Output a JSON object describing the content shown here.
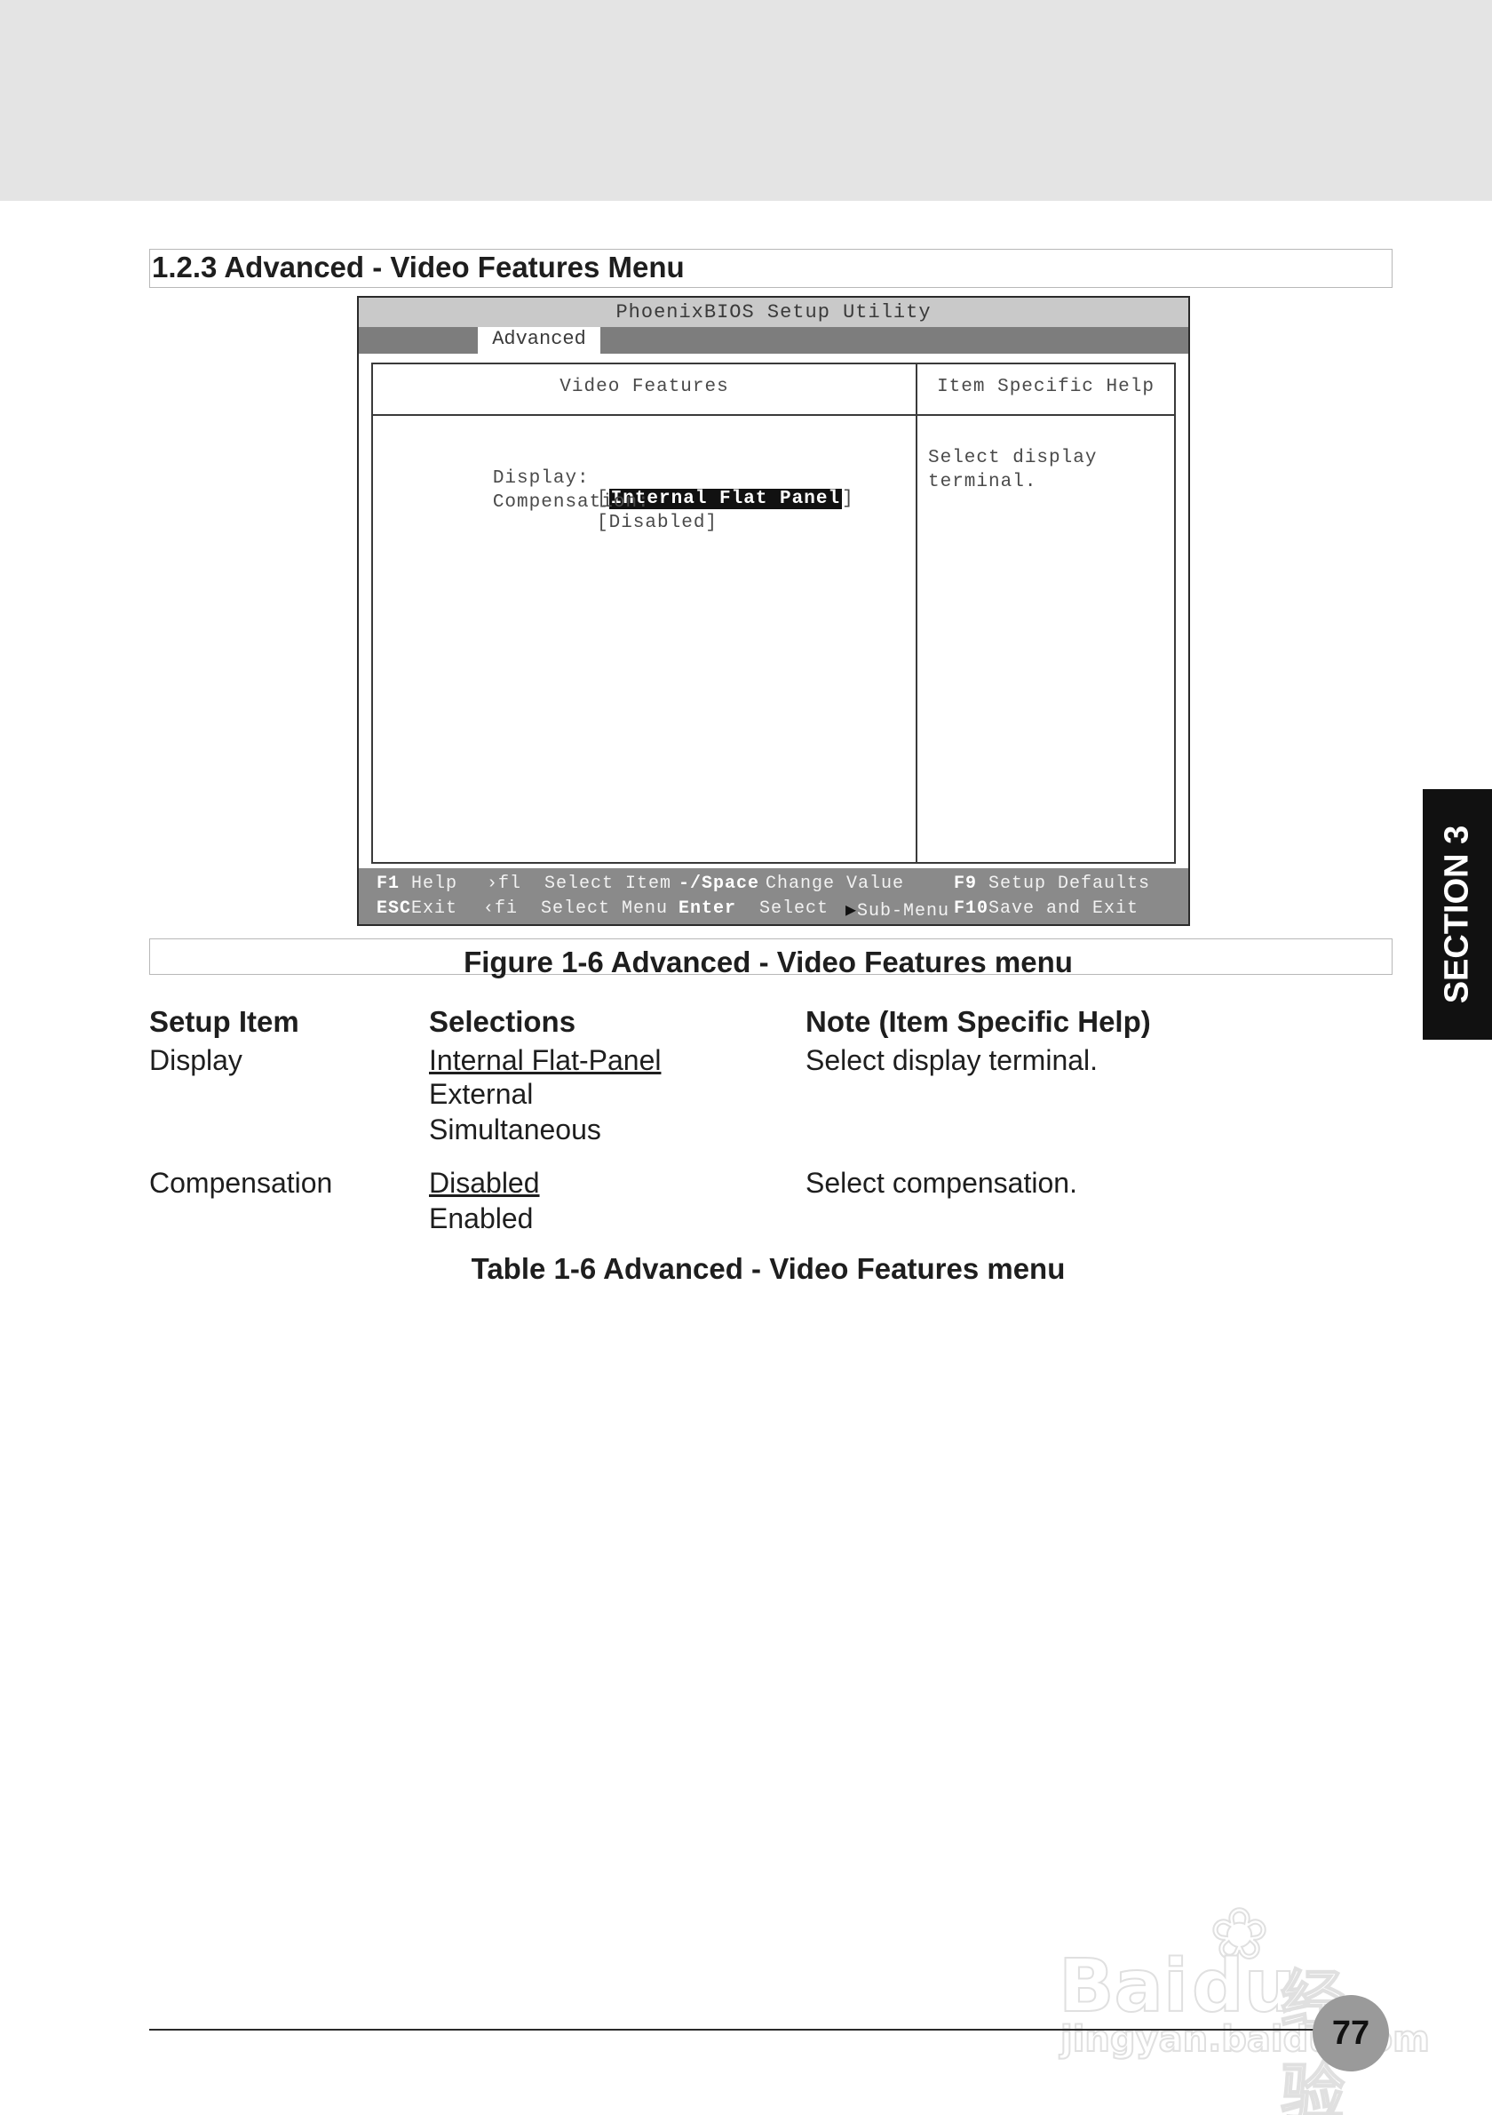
{
  "section_heading": "1.2.3 Advanced - Video Features Menu",
  "bios": {
    "title": "PhoenixBIOS Setup Utility",
    "active_tab": "Advanced",
    "left_panel_header": "Video Features",
    "right_panel_header": "Item Specific Help",
    "items": [
      {
        "label": "Display:",
        "open": "[",
        "value": "Internal Flat Panel",
        "close": "]"
      },
      {
        "label": "Compensation:",
        "value": "[Disabled]"
      }
    ],
    "help_lines": [
      "Select display",
      "terminal."
    ],
    "footer": {
      "row1": [
        {
          "key": "F1",
          "text": " Help"
        },
        {
          "key": "",
          "text": "›fl  Select Item"
        },
        {
          "key": "-/Space",
          "text": "Change Value"
        },
        {
          "key": "F9",
          "text": " Setup Defaults"
        }
      ],
      "row2": [
        {
          "key": "ESC",
          "text": "Exit"
        },
        {
          "key": "",
          "text": "‹fi  Select Menu"
        },
        {
          "key": "Enter",
          "text": "  Select "
        },
        {
          "key": "",
          "text": "Sub-Menu"
        },
        {
          "key": "F10",
          "text": "Save and Exit"
        }
      ]
    }
  },
  "figure_caption": "Figure 1-6 Advanced - Video Features menu",
  "setup_table": {
    "headers": [
      "Setup Item",
      "Selections",
      "Note (Item Specific Help)"
    ],
    "rows": [
      {
        "item": "Display",
        "selections": [
          "Internal Flat-Panel",
          "External",
          "Simultaneous"
        ],
        "default_index": 0,
        "note": "Select display terminal."
      },
      {
        "item": "Compensation",
        "selections": [
          "Disabled",
          "Enabled"
        ],
        "default_index": 0,
        "note": "Select compensation."
      }
    ]
  },
  "table_caption": "Table 1-6 Advanced - Video Features menu",
  "section_tab": "SECTION 3",
  "page_number": "77",
  "watermark": {
    "brand": "Bai",
    "brand2": "du",
    "cn": "经验",
    "url": "jingyan.baidu.com"
  }
}
